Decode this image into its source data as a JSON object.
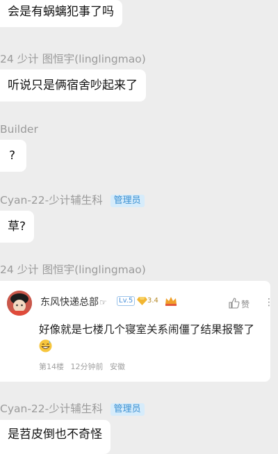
{
  "messages": [
    {
      "text": "会是有蜗螭犯事了吗"
    },
    {
      "sender": "24 少计 图恒宇(linglingmao)",
      "text": "听说只是俩宿舍吵起来了"
    },
    {
      "sender": "Builder",
      "text": "?"
    },
    {
      "sender": "Cyan-22-少计辅生科",
      "badge": "管理员",
      "text": "草?"
    },
    {
      "sender": "24 少计 图恒宇(linglingmao)"
    },
    {
      "sender": "Cyan-22-少计辅生科",
      "badge": "管理员",
      "text": "是苕皮倒也不奇怪"
    }
  ],
  "quoted_comment": {
    "username": "东风快递总部",
    "hand_icon": "☞",
    "level": "Lv.5",
    "gem_count": "3.4",
    "like_label": "赞",
    "more": "⋮",
    "text": "好像就是七楼几个寝室关系闹僵了结果报警了",
    "floor": "第14楼",
    "time": "12分钟前",
    "location": "安徽"
  }
}
